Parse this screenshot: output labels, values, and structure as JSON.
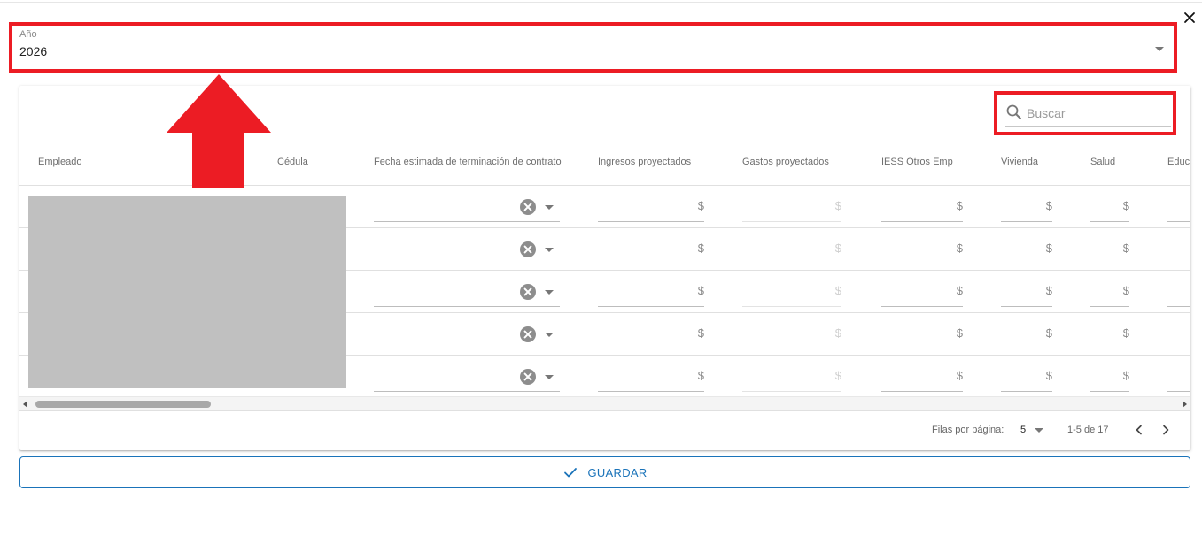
{
  "dialog": {
    "close_icon": "close-icon"
  },
  "year_select": {
    "label": "Año",
    "value": "2026"
  },
  "search": {
    "placeholder": "Buscar",
    "icon": "search-icon"
  },
  "table": {
    "columns": [
      "Empleado",
      "Cédula",
      "Fecha estimada de terminación de contrato",
      "Ingresos proyectados",
      "Gastos proyectados",
      "IESS Otros Emp",
      "Vivienda",
      "Salud",
      "Educa"
    ],
    "currency_symbol": "$",
    "rows": [
      {
        "empleado": "",
        "cedula": "",
        "fecha": "",
        "ingresos": "",
        "gastos": "",
        "iess": "",
        "vivienda": "",
        "salud": "",
        "educacion": ""
      },
      {
        "empleado": "",
        "cedula": "",
        "fecha": "",
        "ingresos": "",
        "gastos": "",
        "iess": "",
        "vivienda": "",
        "salud": "",
        "educacion": ""
      },
      {
        "empleado": "",
        "cedula": "",
        "fecha": "",
        "ingresos": "",
        "gastos": "",
        "iess": "",
        "vivienda": "",
        "salud": "",
        "educacion": ""
      },
      {
        "empleado": "",
        "cedula": "",
        "fecha": "",
        "ingresos": "",
        "gastos": "",
        "iess": "",
        "vivienda": "",
        "salud": "",
        "educacion": ""
      },
      {
        "empleado": "",
        "cedula": "",
        "fecha": "",
        "ingresos": "",
        "gastos": "",
        "iess": "",
        "vivienda": "",
        "salud": "",
        "educacion": ""
      }
    ]
  },
  "pagination": {
    "rows_per_page_label": "Filas por página:",
    "rows_per_page_value": "5",
    "range_text": "1-5 de 17"
  },
  "actions": {
    "save_label": "GUARDAR"
  },
  "colors": {
    "highlight": "#ec1c24",
    "primary": "#1a73b9"
  }
}
